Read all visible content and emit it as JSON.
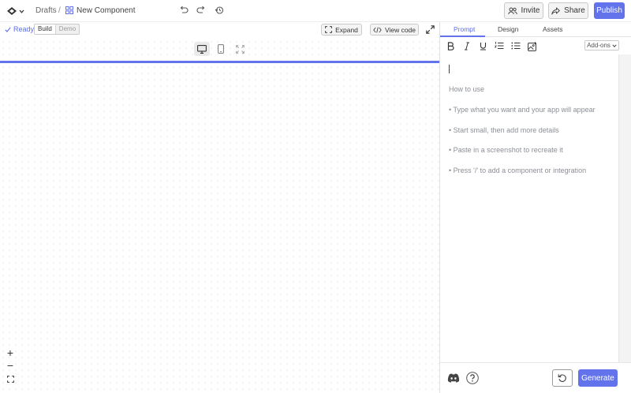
{
  "breadcrumb": {
    "drafts": "Drafts",
    "separator": "/",
    "component": "New Component"
  },
  "actions": {
    "invite": "Invite",
    "share": "Share",
    "publish": "Publish"
  },
  "status": {
    "ready": "Ready",
    "modes": [
      "Build",
      "Demo"
    ]
  },
  "preview": {
    "expand": "Expand",
    "view_code": "View code"
  },
  "zoom": {
    "in": "+",
    "out": "−"
  },
  "panel": {
    "tabs": [
      "Prompt",
      "Design",
      "Assets"
    ],
    "addons": "Add-ons",
    "hints": [
      "How to use",
      "• Type what you want and your app will appear",
      "• Start small, then add more details",
      "• Paste in a screenshot to recreate it",
      "• Press '/' to add a component or integration"
    ],
    "generate": "Generate"
  },
  "colors": {
    "accent": "#6373ec",
    "canvas_dot": "#d6d6d6"
  },
  "icons": [
    "logo-icon",
    "chevron-down-icon",
    "components-icon",
    "undo-icon",
    "redo-icon",
    "history-icon",
    "users-icon",
    "share-icon",
    "check-icon",
    "expand-icon",
    "code-icon",
    "fullscreen-icon",
    "desktop-icon",
    "mobile-icon",
    "fit-screen-icon",
    "bold-icon",
    "italic-icon",
    "underline-icon",
    "ordered-list-icon",
    "bullet-list-icon",
    "image-upload-icon",
    "discord-icon",
    "help-icon",
    "reset-icon"
  ]
}
